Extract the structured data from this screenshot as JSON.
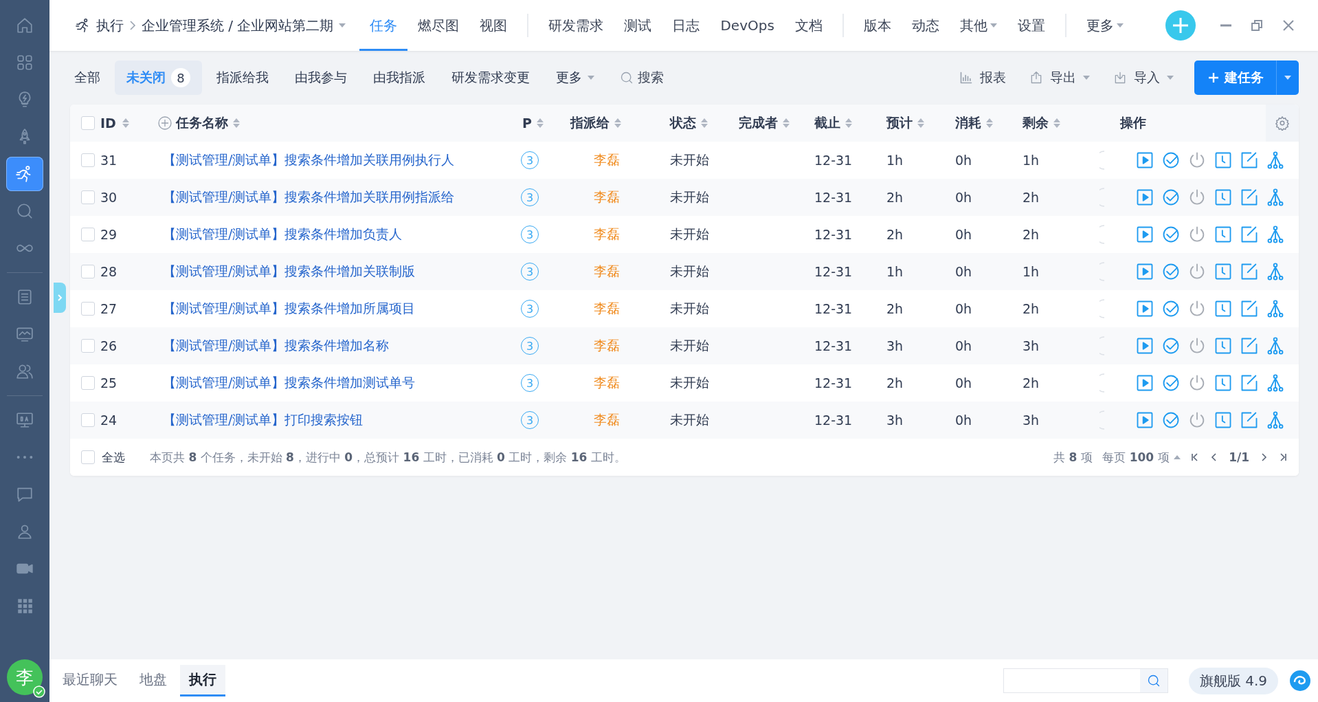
{
  "sidebar": {
    "groups": [
      [
        {
          "kind": "home",
          "selected": false
        },
        {
          "kind": "grid",
          "selected": false
        },
        {
          "kind": "bulb",
          "selected": false
        },
        {
          "kind": "rocket",
          "selected": false
        },
        {
          "kind": "runner",
          "selected": true
        },
        {
          "kind": "search",
          "selected": false
        },
        {
          "kind": "infinity",
          "selected": false
        }
      ],
      [
        {
          "kind": "list",
          "selected": false
        },
        {
          "kind": "monitor",
          "selected": false
        },
        {
          "kind": "people",
          "selected": false
        }
      ],
      [
        {
          "kind": "screen",
          "selected": false
        },
        {
          "kind": "dots",
          "selected": false
        },
        {
          "kind": "chat",
          "selected": false
        },
        {
          "kind": "user",
          "selected": false
        },
        {
          "kind": "video",
          "selected": false
        },
        {
          "kind": "apps",
          "selected": false
        }
      ]
    ],
    "avatar": "李"
  },
  "top_nav": {
    "breadcrumb": [
      "执行",
      "企业管理系统 / 企业网站第二期"
    ],
    "groups": [
      [
        {
          "label": "任务",
          "selected": true,
          "dropdown": false
        },
        {
          "label": "燃尽图",
          "selected": false,
          "dropdown": false
        },
        {
          "label": "视图",
          "selected": false,
          "dropdown": false
        }
      ],
      [
        {
          "label": "研发需求",
          "selected": false,
          "dropdown": false
        },
        {
          "label": "测试",
          "selected": false,
          "dropdown": false
        },
        {
          "label": "日志",
          "selected": false,
          "dropdown": false
        },
        {
          "label": "DevOps",
          "selected": false,
          "dropdown": false
        },
        {
          "label": "文档",
          "selected": false,
          "dropdown": false
        }
      ],
      [
        {
          "label": "版本",
          "selected": false,
          "dropdown": false
        },
        {
          "label": "动态",
          "selected": false,
          "dropdown": false
        },
        {
          "label": "其他",
          "selected": false,
          "dropdown": true
        },
        {
          "label": "设置",
          "selected": false,
          "dropdown": false
        }
      ],
      [
        {
          "label": "更多",
          "selected": false,
          "dropdown": true
        }
      ]
    ]
  },
  "toolbar": {
    "filters": [
      {
        "label": "全部",
        "selected": false,
        "dropdown": false
      },
      {
        "label": "未关闭",
        "selected": true,
        "count": "8",
        "dropdown": false
      },
      {
        "label": "指派给我",
        "selected": false,
        "dropdown": false
      },
      {
        "label": "由我参与",
        "selected": false,
        "dropdown": false
      },
      {
        "label": "由我指派",
        "selected": false,
        "dropdown": false
      },
      {
        "label": "研发需求变更",
        "selected": false,
        "dropdown": false
      },
      {
        "label": "更多",
        "selected": false,
        "dropdown": true
      }
    ],
    "search": "搜索",
    "actions": [
      {
        "label": "报表",
        "kind": "chart"
      },
      {
        "label": "导出",
        "kind": "export"
      },
      {
        "label": "导入",
        "kind": "import"
      }
    ],
    "create_button": "建任务"
  },
  "table": {
    "all_checked": false,
    "columns": [
      "ID",
      "任务名称",
      "P",
      "指派给",
      "状态",
      "完成者",
      "截止",
      "预计",
      "消耗",
      "剩余",
      "操作"
    ],
    "rows": [
      {
        "checked": false,
        "id": "31",
        "name": "【测试管理/测试单】搜索条件增加关联用例执行人",
        "priority": "3",
        "assignee": "李磊",
        "status": "未开始",
        "deadline": "12-31",
        "estimate": "1h",
        "consumed": "0h",
        "remaining": "1h"
      },
      {
        "checked": false,
        "id": "30",
        "name": "【测试管理/测试单】搜索条件增加关联用例指派给",
        "priority": "3",
        "assignee": "李磊",
        "status": "未开始",
        "deadline": "12-31",
        "estimate": "2h",
        "consumed": "0h",
        "remaining": "2h"
      },
      {
        "checked": false,
        "id": "29",
        "name": "【测试管理/测试单】搜索条件增加负责人",
        "priority": "3",
        "assignee": "李磊",
        "status": "未开始",
        "deadline": "12-31",
        "estimate": "2h",
        "consumed": "0h",
        "remaining": "2h"
      },
      {
        "checked": false,
        "id": "28",
        "name": "【测试管理/测试单】搜索条件增加关联制版",
        "priority": "3",
        "assignee": "李磊",
        "status": "未开始",
        "deadline": "12-31",
        "estimate": "1h",
        "consumed": "0h",
        "remaining": "1h"
      },
      {
        "checked": false,
        "id": "27",
        "name": "【测试管理/测试单】搜索条件增加所属项目",
        "priority": "3",
        "assignee": "李磊",
        "status": "未开始",
        "deadline": "12-31",
        "estimate": "2h",
        "consumed": "0h",
        "remaining": "2h"
      },
      {
        "checked": false,
        "id": "26",
        "name": "【测试管理/测试单】搜索条件增加名称",
        "priority": "3",
        "assignee": "李磊",
        "status": "未开始",
        "deadline": "12-31",
        "estimate": "3h",
        "consumed": "0h",
        "remaining": "3h"
      },
      {
        "checked": false,
        "id": "25",
        "name": "【测试管理/测试单】搜索条件增加测试单号",
        "priority": "3",
        "assignee": "李磊",
        "status": "未开始",
        "deadline": "12-31",
        "estimate": "2h",
        "consumed": "0h",
        "remaining": "2h"
      },
      {
        "checked": false,
        "id": "24",
        "name": "【测试管理/测试单】打印搜索按钮",
        "priority": "3",
        "assignee": "李磊",
        "status": "未开始",
        "deadline": "12-31",
        "estimate": "3h",
        "consumed": "0h",
        "remaining": "3h"
      }
    ],
    "footer": {
      "select_all": "全选",
      "select_all_checked": false,
      "summary": "本页共 **8** 个任务，未开始 **8**，进行中 **0**，总预计 **16** 工时，已消耗 **0** 工时，剩余 **16** 工时。",
      "total": "共 **8** 项",
      "per_page": "每页 **100** 项",
      "page": "1/1"
    }
  },
  "bottom_bar": {
    "tabs": [
      {
        "label": "最近聊天",
        "selected": false
      },
      {
        "label": "地盘",
        "selected": false
      },
      {
        "label": "执行",
        "selected": true
      }
    ],
    "version": "旗舰版 4.9"
  }
}
